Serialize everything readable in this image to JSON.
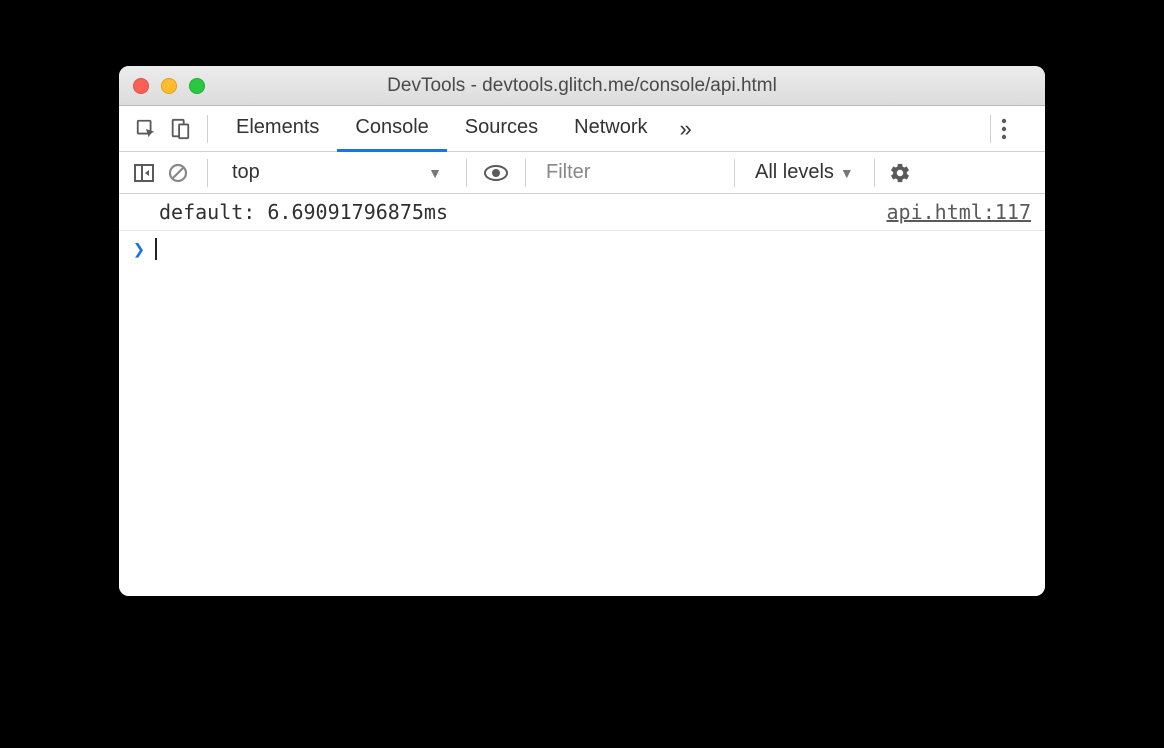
{
  "window": {
    "title": "DevTools - devtools.glitch.me/console/api.html"
  },
  "tabs": {
    "items": [
      "Elements",
      "Console",
      "Sources",
      "Network"
    ],
    "active_index": 1,
    "overflow_glyph": "»"
  },
  "toolbar": {
    "context": "top",
    "filter_placeholder": "Filter",
    "levels_label": "All levels"
  },
  "console": {
    "rows": [
      {
        "message": "default: 6.69091796875ms",
        "source": "api.html:117"
      }
    ],
    "prompt_glyph": "❯"
  }
}
